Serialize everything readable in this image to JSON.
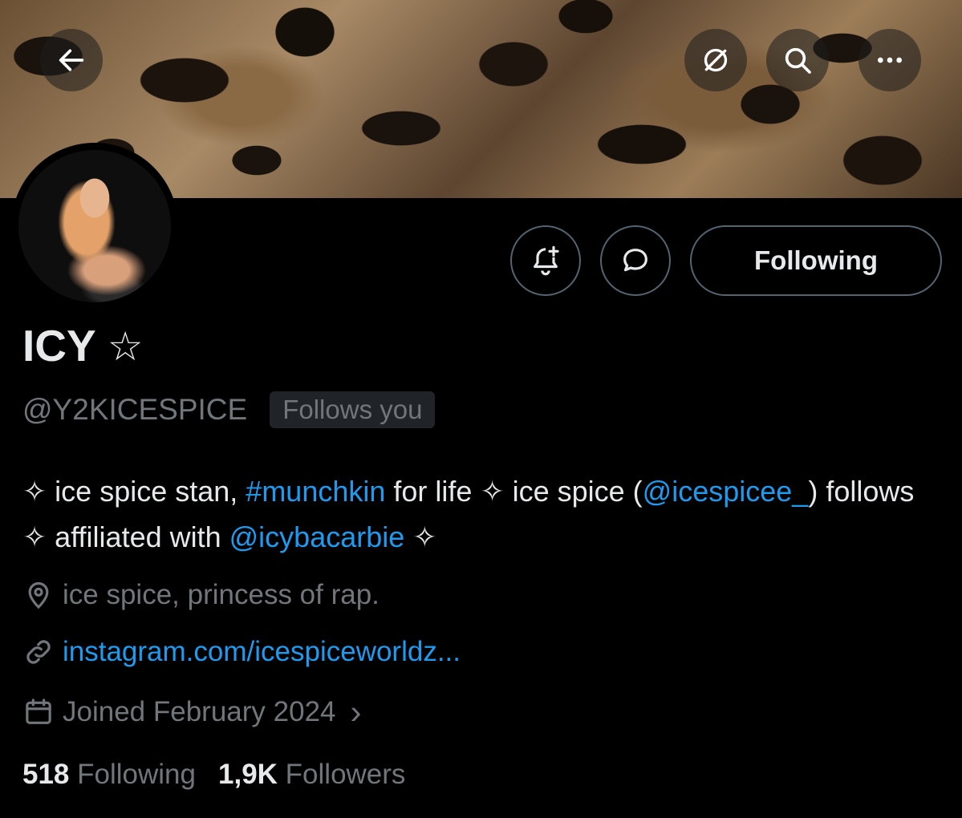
{
  "banner": {
    "back_icon": "arrow-left-icon",
    "grok_icon": "slashed-circle-icon",
    "search_icon": "search-icon",
    "more_icon": "more-horizontal-icon"
  },
  "actions": {
    "notify_icon": "bell-plus-icon",
    "message_icon": "chat-bubble-icon",
    "following_label": "Following"
  },
  "profile": {
    "name": "ICY",
    "name_star": "☆",
    "handle": "@Y2KICESPICE",
    "follows_you": "Follows you"
  },
  "bio": {
    "spark1": "✧",
    "t1": " ice spice stan, ",
    "hashtag": "#munchkin",
    "t2": " for life ",
    "spark2": "✧",
    "t3": " ice spice (",
    "mention1": "@icespicee_",
    "t4": ") follows ",
    "spark3": "✧",
    "t5": " affiliated with ",
    "mention2": "@icybacarbie",
    "t6": " ",
    "spark4": "✧"
  },
  "meta": {
    "location": "ice spice, princess of rap.",
    "link": "instagram.com/icespiceworldz...",
    "joined": "Joined February 2024",
    "joined_chevron": "›"
  },
  "stats": {
    "following_count": "518",
    "following_label": "Following",
    "followers_count": "1,9K",
    "followers_label": "Followers"
  },
  "colors": {
    "accent": "#1d9bf0",
    "muted": "#71767b",
    "text": "#e7e9ea",
    "border": "#536471"
  }
}
